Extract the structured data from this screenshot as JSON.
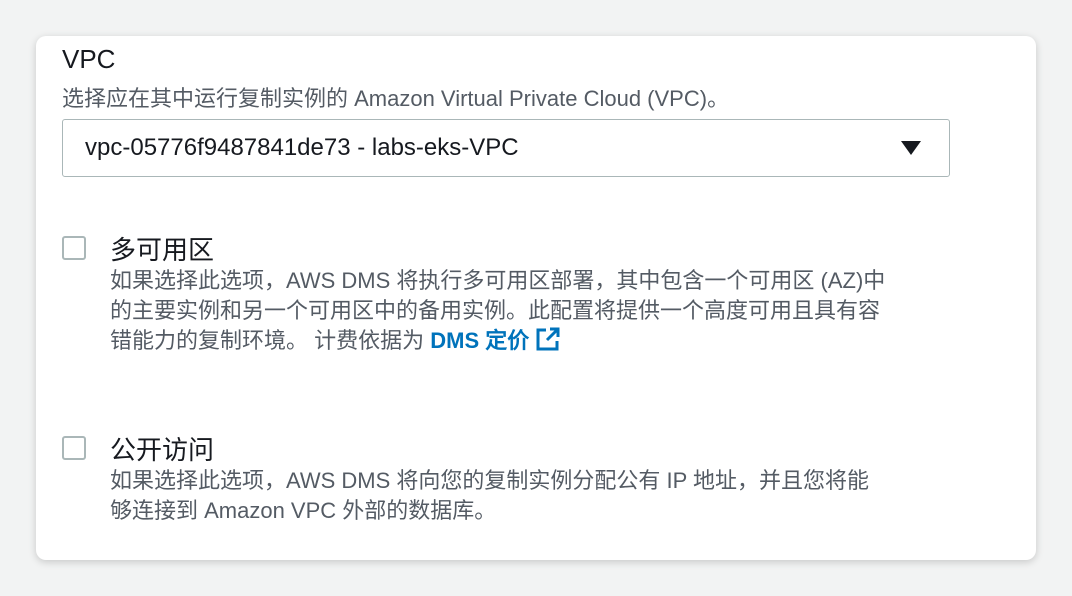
{
  "vpc": {
    "label": "VPC",
    "description": "选择应在其中运行复制实例的 Amazon Virtual Private Cloud (VPC)。",
    "selected_value": "vpc-05776f9487841de73 - labs-eks-VPC"
  },
  "multi_az": {
    "title": "多可用区",
    "checked": false,
    "desc_lines": [
      "如果选择此选项，AWS DMS 将执行多可用区部署，其中包含一个可用区 (AZ)中",
      "的主要实例和另一个可用区中的备用实例。此配置将提供一个高度可用且具有容",
      "错能力的复制环境。 计费依据为 "
    ],
    "link_text": "DMS 定价",
    "link_icon": "external-link-icon"
  },
  "public_access": {
    "title": "公开访问",
    "checked": false,
    "desc_lines": [
      "如果选择此选项，AWS DMS 将向您的复制实例分配公有 IP 地址，并且您将能",
      "够连接到 Amazon VPC 外部的数据库。"
    ]
  },
  "colors": {
    "link": "#0073bb",
    "text": "#16191f",
    "secondary_text": "#545b64",
    "border": "#aab7b8"
  }
}
